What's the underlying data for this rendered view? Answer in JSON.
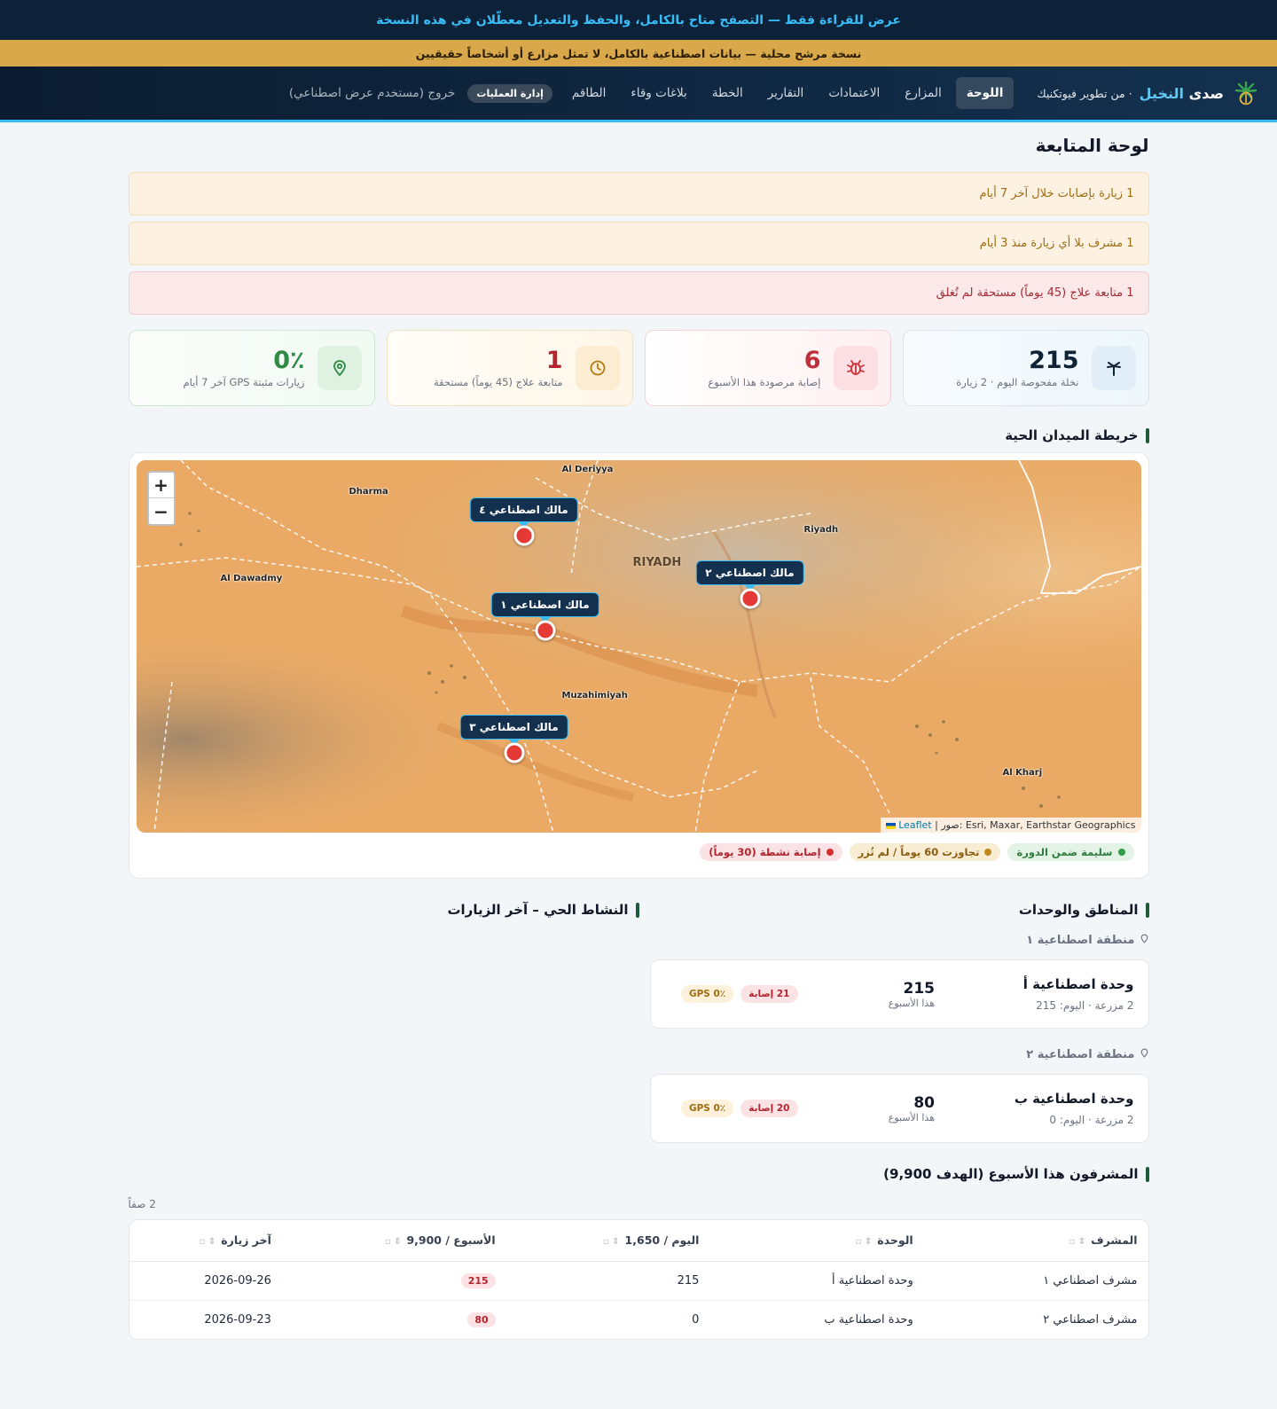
{
  "banner": {
    "readonly": "عرض للقراءة فقط — التصفح متاح بالكامل، والحفظ والتعديل معطّلان في هذه النسخة",
    "preview": "نسخة مرشح محلية — بيانات اصطناعية بالكامل، لا تمثل مزارع أو أشخاصاً حقيقيين"
  },
  "nav": {
    "brand_name_a": "صدى",
    "brand_name_b": "النخيل",
    "brand_sub": "· من تطوير فيوتكنيك",
    "links": [
      "اللوحة",
      "المزارع",
      "الاعتمادات",
      "التقارير",
      "الخطة",
      "بلاغات وقاء",
      "الطاقم"
    ],
    "ops_badge": "إدارة العمليات",
    "logout": "خروج (مستخدم عرض اصطناعي)"
  },
  "page": {
    "title": "لوحة المتابعة",
    "alerts": [
      {
        "type": "warn",
        "text": "1 زيارة بإصابات خلال آخر 7 أيام"
      },
      {
        "type": "warn",
        "text": "1 مشرف بلا أي زيارة منذ 3 أيام"
      },
      {
        "type": "danger",
        "text": "1 متابعة علاج (45 يوماً) مستحقة لم تُغلق"
      }
    ]
  },
  "stats": [
    {
      "value": "215",
      "label": "نخلة مفحوصة اليوم · 2 زيارة",
      "icon": "palm-icon"
    },
    {
      "value": "6",
      "label": "إصابة مرصودة هذا الأسبوع",
      "icon": "bug-icon"
    },
    {
      "value": "1",
      "label": "متابعة علاج (45 يوماً) مستحقة",
      "icon": "clock-icon"
    },
    {
      "value": "0٪",
      "label": "زيارات مثبتة GPS آخر 7 أيام",
      "icon": "map-pin-icon"
    }
  ],
  "map_section": {
    "title": "خريطة الميدان الحية",
    "zoom_in": "+",
    "zoom_out": "−",
    "attribution_leaflet": "Leaflet",
    "attribution_rest": "| صور: Esri, Maxar, Earthstar Geographics",
    "places": [
      "Al Deriyya",
      "Dharma",
      "Riyadh",
      "RIYADH",
      "Al Dawadmy",
      "Muzahimiyah",
      "Al Kharj"
    ],
    "markers": [
      "مالك اصطناعي ٤",
      "مالك اصطناعي ٢",
      "مالك اصطناعي ١",
      "مالك اصطناعي ٣"
    ],
    "legend": [
      {
        "text": "سليمة ضمن الدورة",
        "color": "#2e9d48"
      },
      {
        "text": "تجاوزت 60 يوماً / لم تُزر",
        "color": "#c0891c"
      },
      {
        "text": "إصابة نشطة (30 يوماً)",
        "color": "#d32f2f"
      }
    ]
  },
  "regions_section": {
    "title": "المناطق والوحدات",
    "regions": [
      {
        "name": "منطقة اصطناعية ١",
        "unit": {
          "title": "وحدة اصطناعية أ",
          "sub": "2 مزرعة · اليوم: 215",
          "week_value": "215",
          "week_label": "هذا الأسبوع",
          "infections": "21 إصابة",
          "gps": "GPS 0٪"
        }
      },
      {
        "name": "منطقة اصطناعية ٢",
        "unit": {
          "title": "وحدة اصطناعية ب",
          "sub": "2 مزرعة · اليوم: 0",
          "week_value": "80",
          "week_label": "هذا الأسبوع",
          "infections": "20 إصابة",
          "gps": "GPS 0٪"
        }
      }
    ]
  },
  "activity_section": {
    "title": "النشاط الحي – آخر الزيارات"
  },
  "supervisors_section": {
    "title": "المشرفون هذا الأسبوع (الهدف 9,900)",
    "rows_count": "2 صفاً",
    "columns": [
      "المشرف",
      "الوحدة",
      "اليوم / 1,650",
      "الأسبوع / 9,900",
      "آخر زيارة"
    ],
    "rows": [
      {
        "supervisor": "مشرف اصطناعي ١",
        "unit": "وحدة اصطناعية أ",
        "today": "215",
        "week": "215",
        "last": "2026-09-26"
      },
      {
        "supervisor": "مشرف اصطناعي ٢",
        "unit": "وحدة اصطناعية ب",
        "today": "0",
        "week": "80",
        "last": "2026-09-23"
      }
    ]
  },
  "colors": {
    "navy": "#0d2238",
    "accent": "#38bdf8",
    "gold": "#d8a84a",
    "danger": "#d32f2f",
    "success": "#2e9d48"
  }
}
